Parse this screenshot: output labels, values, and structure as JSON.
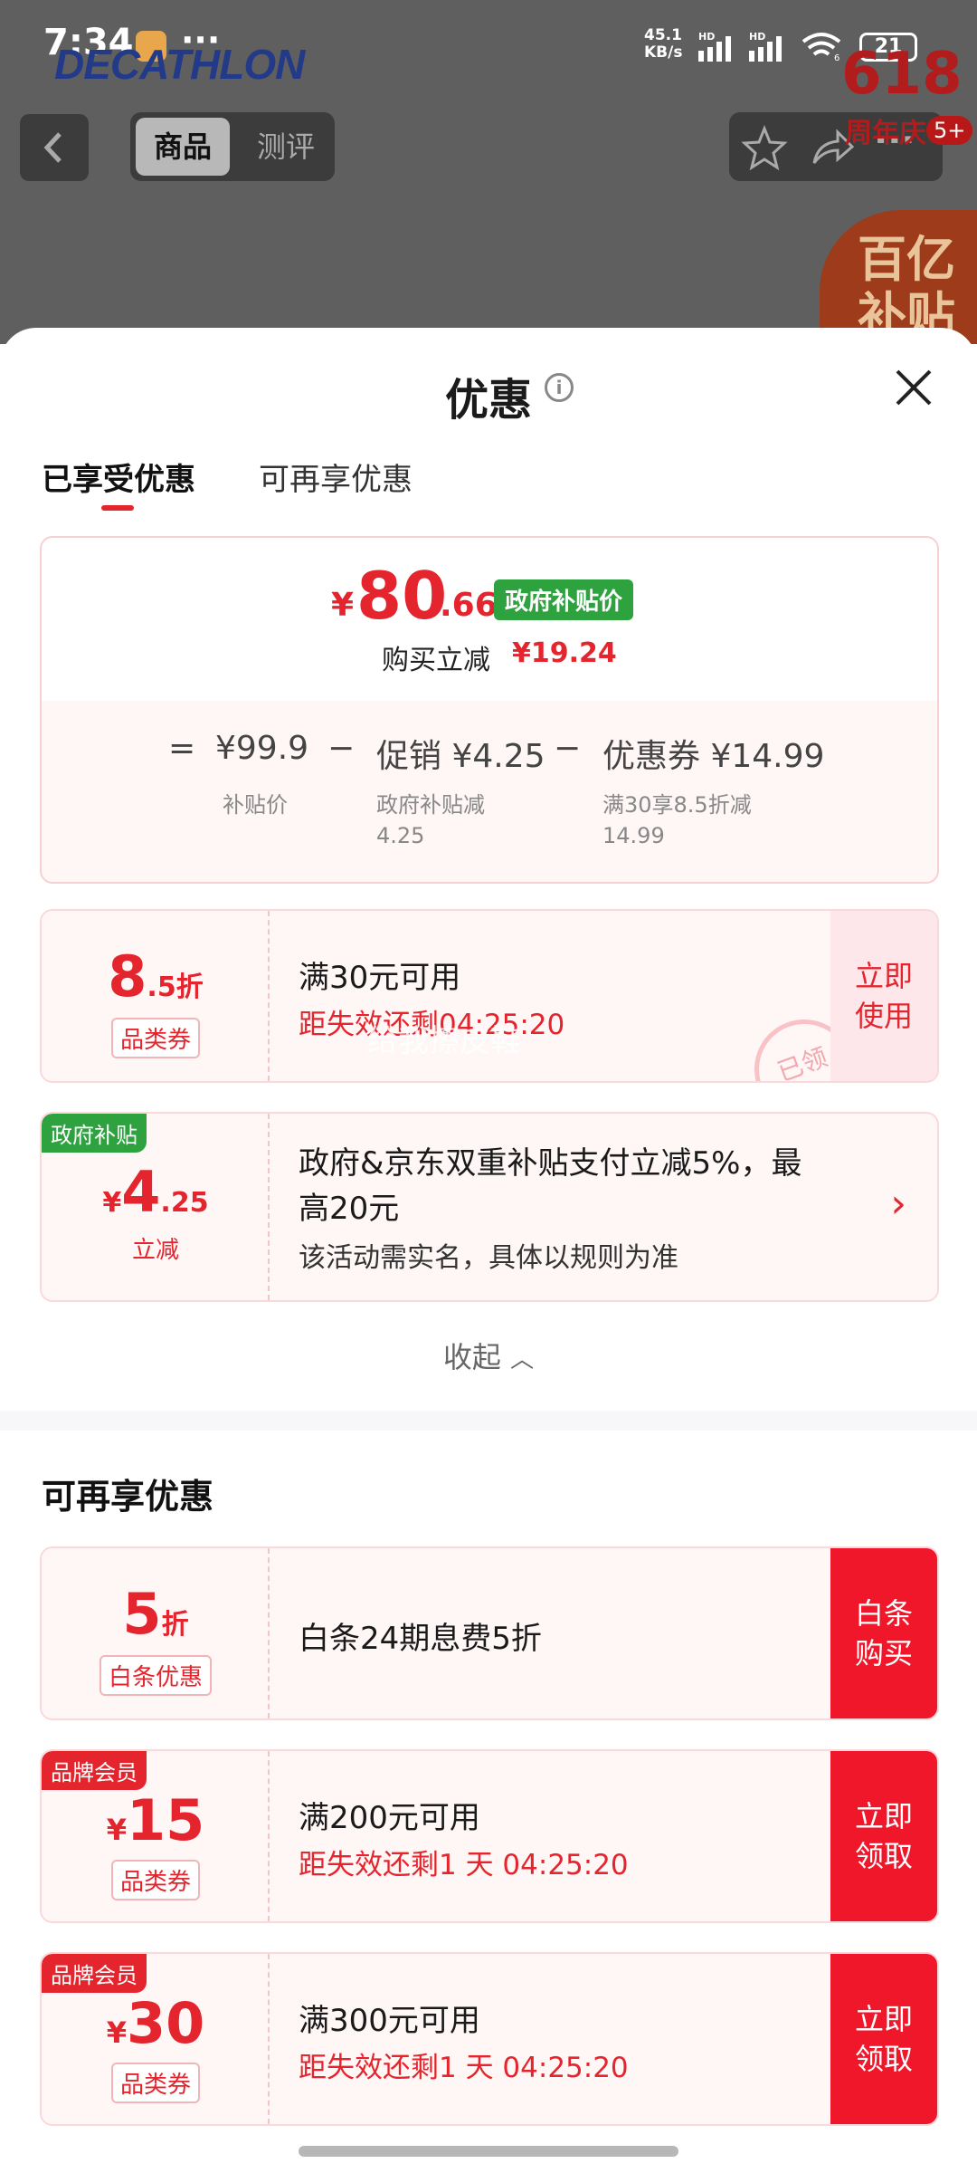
{
  "status_bar": {
    "time": "7:34",
    "dots": "···",
    "net_speed_top": "45.1",
    "net_speed_bottom": "KB/s",
    "hd1": "HD",
    "hd2": "HD",
    "battery": "21",
    "wifi_sub": "6"
  },
  "background_page": {
    "brand": "DECATHLON",
    "seg_product": "商品",
    "seg_review": "测评",
    "promo_618": "618",
    "promo_618_sub": "周年庆",
    "badge": "5+",
    "subsidy_badge": "百亿补贴"
  },
  "sheet": {
    "title": "优惠",
    "tabs": [
      {
        "label": "已享受优惠",
        "active": true
      },
      {
        "label": "可再享优惠",
        "active": false
      }
    ],
    "summary": {
      "yen": "¥",
      "price_int": "80",
      "price_dec": ".66",
      "tag": "政府补贴价",
      "reduce_label": "购买立减",
      "reduce_amount": "¥19.24",
      "formula": {
        "eq": "=",
        "base": "¥99.9",
        "minus1": "−",
        "promo": "促销 ¥4.25",
        "minus2": "−",
        "coupon": "优惠券 ¥14.99",
        "base_note": "补贴价",
        "promo_note_1": "政府补贴减",
        "promo_note_2": "4.25",
        "coupon_note_1": "满30享8.5折减",
        "coupon_note_2": "14.99"
      }
    },
    "enjoyed": [
      {
        "val_big": "8",
        "val_small": ".5折",
        "type": "品类券",
        "title": "满30元可用",
        "sub": "距失效还剩04:25:20",
        "btn": "立即\n使用",
        "watermark": "给我擦皮鞋",
        "stamp": "已领"
      },
      {
        "corner": "政府补贴",
        "yen": "¥",
        "val_big": "4",
        "val_small": ".25",
        "type": "立减",
        "title_1": "政府&京东双重补贴支付立减5%，最",
        "title_2": "高20元",
        "sub": "该活动需实名，具体以规则为准",
        "arrow": "›"
      }
    ],
    "collapse_label": "收起",
    "more_title": "可再享优惠",
    "more": [
      {
        "val_big": "5",
        "val_small": "折",
        "type": "白条优惠",
        "title": "白条24期息费5折",
        "btn": "白条\n购买"
      },
      {
        "corner": "品牌会员",
        "yen": "¥",
        "val_big": "15",
        "type": "品类券",
        "title": "满200元可用",
        "sub": "距失效还剩1 天 04:25:20",
        "btn": "立即\n领取"
      },
      {
        "corner": "品牌会员",
        "yen": "¥",
        "val_big": "30",
        "type": "品类券",
        "title": "满300元可用",
        "sub": "距失效还剩1 天 04:25:20",
        "btn": "立即\n领取"
      }
    ]
  },
  "colors": {
    "accent_red": "#e4252d",
    "green_tag": "#2ea23f",
    "button_red": "#f0172b"
  }
}
